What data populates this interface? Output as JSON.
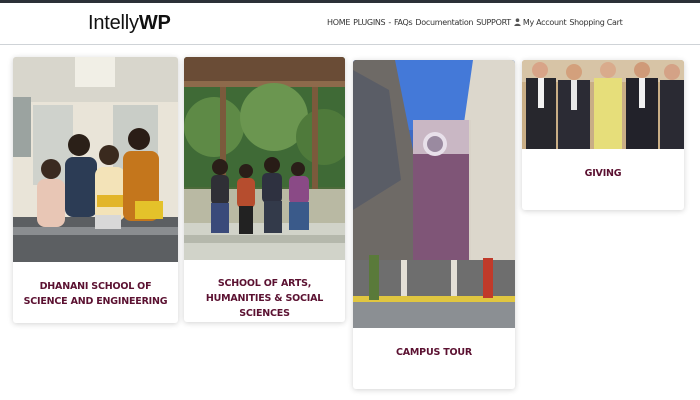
{
  "brand": {
    "logo_prefix": "Intelly",
    "logo_suffix": "WP"
  },
  "nav": {
    "items": [
      "HOME",
      "PLUGINS",
      "FAQs",
      "Documentation",
      "SUPPORT",
      "My Account",
      "Shopping Cart"
    ],
    "separator": "-",
    "account_icon": "user-icon"
  },
  "cards": [
    {
      "title": "DHANANI SCHOOL OF SCIENCE AND ENGINEERING",
      "image": "lab-students-photo"
    },
    {
      "title": "SCHOOL OF ARTS, HUMANITIES & SOCIAL SCIENCES",
      "image": "students-sitting-photo"
    },
    {
      "title": "CAMPUS TOUR",
      "image": "campus-building-photo"
    },
    {
      "title": "GIVING",
      "image": "donors-group-photo"
    }
  ],
  "colors": {
    "card_title": "#5b1131",
    "topline": "#2c3138"
  }
}
